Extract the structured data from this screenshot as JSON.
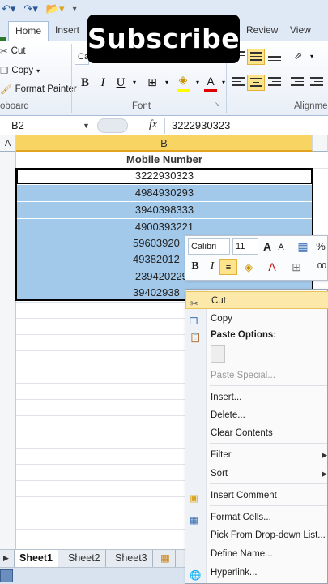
{
  "ribbon": {
    "tabs": {
      "home": "Home",
      "insert": "Insert",
      "review": "Review",
      "view": "View"
    },
    "clipboard": {
      "cut": "Cut",
      "copy": "Copy",
      "format_painter": "Format Painter",
      "group_label": "oboard"
    },
    "font": {
      "name_partial": "Ca",
      "group_label": "Font"
    },
    "alignment": {
      "group_label": "Alignme"
    }
  },
  "overlay": {
    "subscribe": "Subscribe"
  },
  "formula_bar": {
    "name_box": "B2",
    "fx": "fx",
    "value": "3222930323"
  },
  "grid": {
    "columns": [
      "A",
      "B"
    ],
    "header": "Mobile Number",
    "cells": [
      "3222930323",
      "4984930293",
      "3940398333",
      "4900393221",
      "59603920",
      "49382012",
      "2394202291",
      "39402938"
    ]
  },
  "mini_toolbar": {
    "font": "Calibri",
    "size": "11",
    "bold": "B",
    "italic": "I",
    "grow": "A",
    "shrink": "A",
    "percent": "%",
    "decimals": ".00"
  },
  "context_menu": {
    "cut": "Cut",
    "copy": "Copy",
    "paste_options": "Paste Options:",
    "paste_special": "Paste Special...",
    "insert": "Insert...",
    "delete": "Delete...",
    "clear_contents": "Clear Contents",
    "filter": "Filter",
    "sort": "Sort",
    "insert_comment": "Insert Comment",
    "format_cells": "Format Cells...",
    "pick_dropdown": "Pick From Drop-down List...",
    "define_name": "Define Name...",
    "hyperlink": "Hyperlink..."
  },
  "sheets": [
    "Sheet1",
    "Sheet2",
    "Sheet3"
  ],
  "colors": {
    "selection": "#a3c9ea",
    "highlight": "#fce9a9",
    "header_selected": "#f8d462",
    "accent": "#2b5797"
  }
}
